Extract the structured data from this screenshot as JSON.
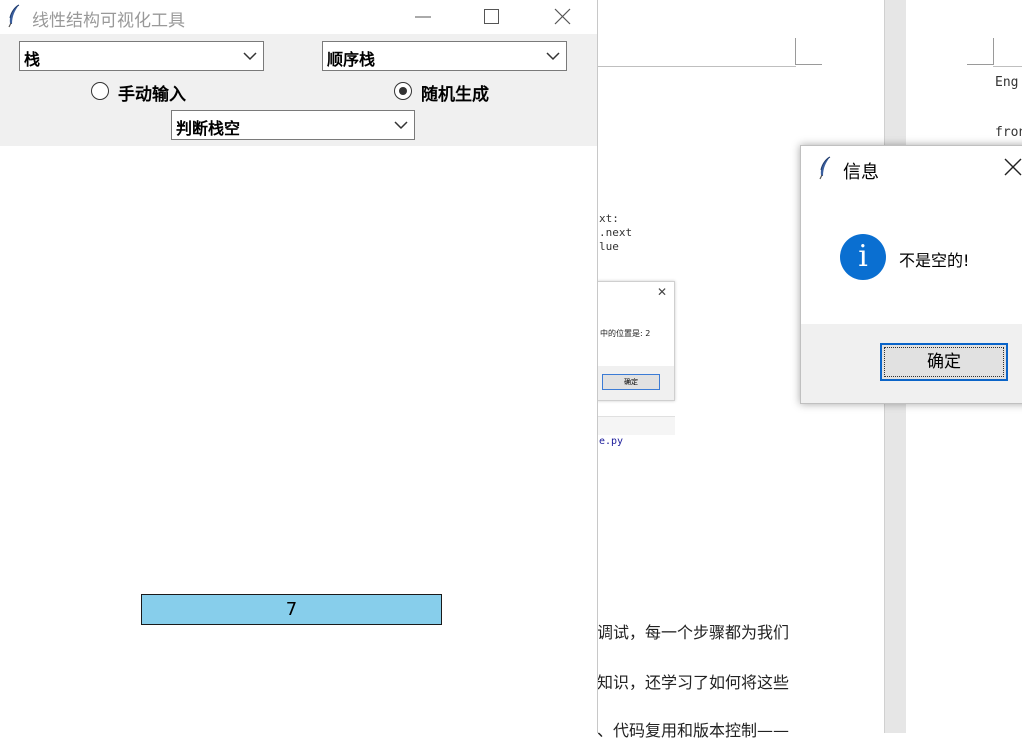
{
  "main_window": {
    "title": "线性结构可视化工具",
    "structure_select": {
      "value": "栈"
    },
    "impl_select": {
      "value": "顺序栈"
    },
    "input_mode": {
      "options": [
        {
          "label": "手动输入",
          "selected": false
        },
        {
          "label": "随机生成",
          "selected": true
        }
      ]
    },
    "operation_select": {
      "value": "判断栈空"
    },
    "canvas": {
      "stack_elements": [
        "7"
      ],
      "element_fill": "#87ceeb"
    }
  },
  "info_dialog": {
    "title": "信息",
    "icon": "info-icon",
    "icon_glyph": "i",
    "message": "不是空的!",
    "ok_label": "确定",
    "accent": "#0a6fd1"
  },
  "background": {
    "code_lines": [
      "xt:",
      ".next",
      "lue"
    ],
    "code_right": [
      "Eng",
      "fron"
    ],
    "small_dialog": {
      "message": "中的位置是: 2",
      "ok_label": "确定"
    },
    "file_link": "e.py",
    "paragraph_lines": [
      "调试，每一个步骤都为我们",
      "知识，还学习了如何将这些",
      "、代码复用和版本控制——"
    ]
  }
}
